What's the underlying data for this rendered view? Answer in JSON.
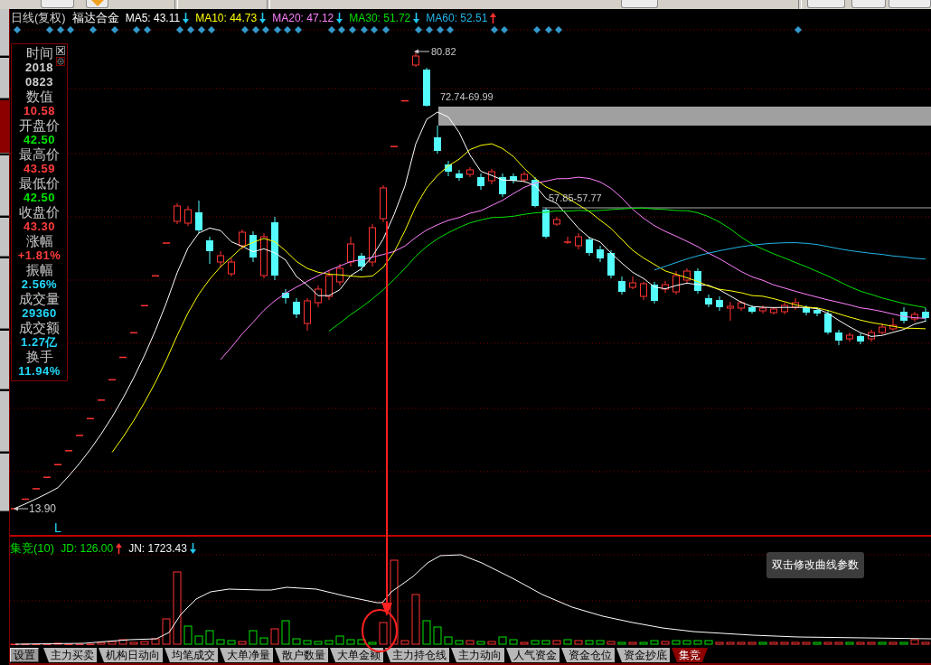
{
  "toolbar": {
    "items": [
      {
        "kind": "button"
      },
      {
        "kind": "icon-button"
      },
      {
        "kind": "separator"
      },
      {
        "kind": "separator"
      },
      {
        "kind": "button"
      },
      {
        "kind": "separator"
      },
      {
        "kind": "button"
      },
      {
        "kind": "button"
      },
      {
        "kind": "button"
      }
    ]
  },
  "side_tabs": [
    {
      "selected": false
    },
    {
      "selected": false
    },
    {
      "selected": true
    },
    {
      "selected": false
    },
    {
      "selected": false
    },
    {
      "selected": false
    },
    {
      "selected": false
    },
    {
      "selected": false
    },
    {
      "selected": false
    }
  ],
  "chart": {
    "period": "日线(复权)",
    "stock_name": "福达合金",
    "moving_averages": [
      {
        "label": "MA5: 43.11",
        "rising": false,
        "color": "#ffffff"
      },
      {
        "label": "MA10: 44.73",
        "rising": false,
        "color": "#ffff00"
      },
      {
        "label": "MA20: 47.12",
        "rising": false,
        "color": "#ff80ff"
      },
      {
        "label": "MA30: 51.72",
        "rising": false,
        "color": "#00e000"
      },
      {
        "label": "MA60: 52.51",
        "rising": true,
        "color": "#22b4e6"
      }
    ],
    "price_labels": {
      "high": "80.82",
      "gap_upper": "72.74-69.99",
      "gap_lower": "57.85-57.77",
      "low": "13.90"
    },
    "marker": "L"
  },
  "info_panel": {
    "rows": [
      {
        "label": "时间",
        "values": [
          "2018",
          "0823"
        ],
        "color": "#d0d0d0"
      },
      {
        "label": "数值",
        "values": [
          "10.58"
        ],
        "color": "#ff3c3c"
      },
      {
        "label": "开盘价",
        "values": [
          "42.50"
        ],
        "color": "#00e600"
      },
      {
        "label": "最高价",
        "values": [
          "43.59"
        ],
        "color": "#ff3c3c"
      },
      {
        "label": "最低价",
        "values": [
          "42.50"
        ],
        "color": "#00e600"
      },
      {
        "label": "收盘价",
        "values": [
          "43.30"
        ],
        "color": "#ff3c3c"
      },
      {
        "label": "涨幅",
        "values": [
          "+1.81%"
        ],
        "color": "#ff3c3c"
      },
      {
        "label": "振幅",
        "values": [
          "2.56%"
        ],
        "color": "#22d8f8"
      },
      {
        "label": "成交量",
        "values": [
          "29360"
        ],
        "color": "#22d8f8"
      },
      {
        "label": "成交额",
        "values": [
          "1.27亿"
        ],
        "color": "#22d8f8"
      },
      {
        "label": "换手",
        "values": [
          "11.94%"
        ],
        "color": "#22d8f8"
      }
    ]
  },
  "indicator": {
    "title": "集竞(10)",
    "lines": [
      {
        "label": "JD: 126.00",
        "rising": true,
        "color": "#00e000"
      },
      {
        "label": "JN: 1723.43",
        "rising": false,
        "color": "#f0f0f0"
      }
    ],
    "tooltip": "双击修改曲线参数"
  },
  "settings_button": {
    "label": "设置"
  },
  "indicator_tabs": [
    {
      "label": "主力买卖",
      "selected": false
    },
    {
      "label": "机构日动向",
      "selected": false
    },
    {
      "label": "均笔成交",
      "selected": false
    },
    {
      "label": "大单净量",
      "selected": false
    },
    {
      "label": "散户数量",
      "selected": false
    },
    {
      "label": "大单金额",
      "selected": false
    },
    {
      "label": "主力持仓线",
      "selected": false
    },
    {
      "label": "主力动向",
      "selected": false
    },
    {
      "label": "人气资金",
      "selected": false
    },
    {
      "label": "资金仓位",
      "selected": false
    },
    {
      "label": "资金抄底",
      "selected": false
    },
    {
      "label": "集竞",
      "selected": true
    }
  ]
}
